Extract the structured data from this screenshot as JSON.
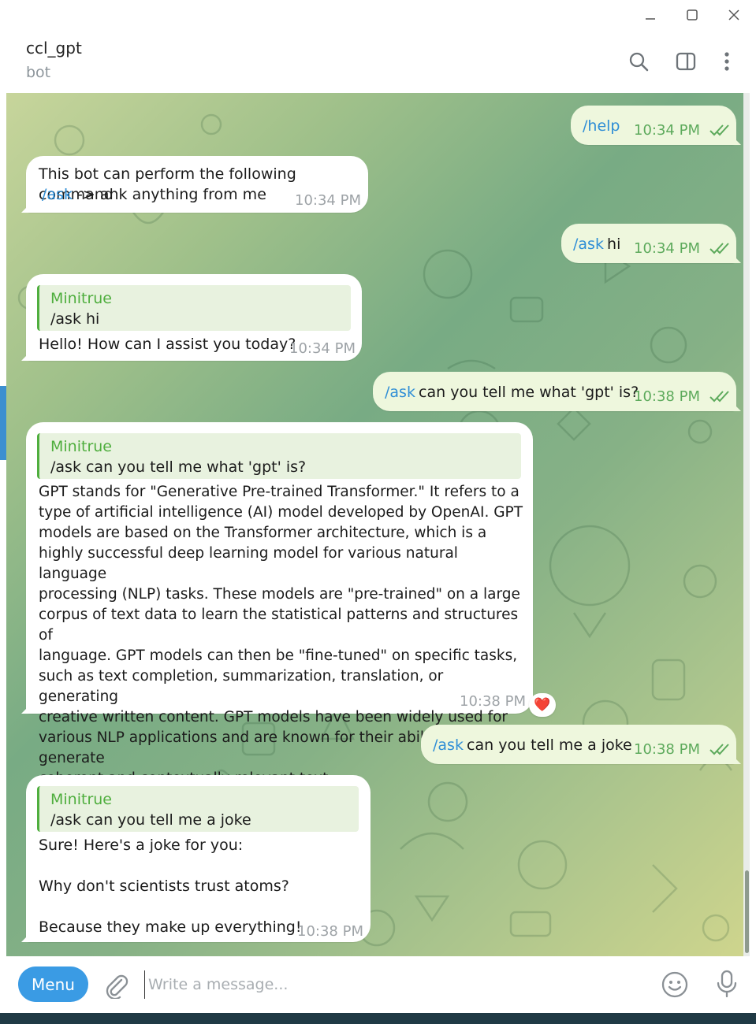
{
  "window": {
    "minimize_icon": "minimize-icon",
    "maximize_icon": "maximize-icon",
    "close_icon": "close-icon"
  },
  "header": {
    "title": "ccl_gpt",
    "subtitle": "bot",
    "icons": [
      "search-icon",
      "sidebar-toggle-icon",
      "more-vertical-icon"
    ]
  },
  "messages": {
    "m1": {
      "text": "/help",
      "time": "10:34 PM"
    },
    "m2": {
      "line1": "This bot can perform the following command",
      "cmd": "/ask",
      "line2_rest": " -> ank anything from me",
      "time": "10:34 PM"
    },
    "m3": {
      "cmd": "/ask",
      "rest": " hi",
      "time": "10:34 PM"
    },
    "m4": {
      "quote_name": "Minitrue",
      "quote_text": "/ask hi",
      "text": "Hello! How can I assist you today?",
      "time": "10:34 PM"
    },
    "m5": {
      "cmd": "/ask",
      "rest": " can you tell me what 'gpt' is?",
      "time": "10:38 PM"
    },
    "m6": {
      "quote_name": "Minitrue",
      "quote_text": "/ask can you tell me what 'gpt' is?",
      "text": "GPT stands for \"Generative Pre-trained Transformer.\" It refers to a\ntype of artificial intelligence (AI) model developed by OpenAI. GPT\nmodels are based on the Transformer architecture, which is a\nhighly successful deep learning model for various natural language\nprocessing (NLP) tasks. These models are \"pre-trained\" on a large\ncorpus of text data to learn the statistical patterns and structures of\nlanguage. GPT models can then be \"fine-tuned\" on specific tasks,\nsuch as text completion, summarization, translation, or generating\ncreative written content. GPT models have been widely used for\nvarious NLP applications and are known for their ability to generate\ncoherent and contextually relevant text.",
      "time": "10:38 PM",
      "reaction": "❤️"
    },
    "m7": {
      "cmd": "/ask",
      "rest": " can you tell me a joke",
      "time": "10:38 PM"
    },
    "m8": {
      "quote_name": "Minitrue",
      "quote_text": "/ask can you tell me a joke",
      "text": "Sure! Here's a joke for you:\n\nWhy don't scientists trust atoms?\n\nBecause they make up everything!",
      "time": "10:38 PM"
    }
  },
  "composer": {
    "menu_label": "Menu",
    "placeholder": "Write a message...",
    "icons": [
      "paperclip-icon",
      "emoji-icon",
      "microphone-icon"
    ]
  },
  "colors": {
    "accent": "#3a9be4",
    "link": "#2f8ed6",
    "quote_green": "#4fae3e",
    "outgoing_bubble": "#eef7dd"
  }
}
